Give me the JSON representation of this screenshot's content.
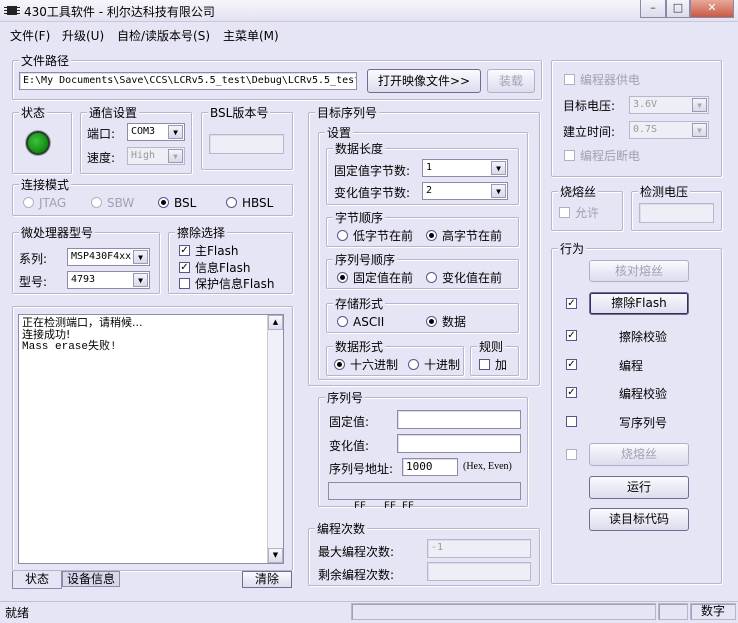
{
  "window": {
    "title": "430工具软件 - 利尔达科技有限公司"
  },
  "menu": [
    "文件(F)",
    "升级(U)",
    "自检/读版本号(S)",
    "主菜单(M)"
  ],
  "file_path": {
    "label": "文件路径",
    "value": "E:\\My Documents\\Save\\CCS\\LCRv5.5_test\\Debug\\LCRv5.5_test",
    "open_button": "打开映像文件>>",
    "load_button": "装载"
  },
  "power": {
    "supply_label": "编程器供电",
    "voltage_label": "目标电压:",
    "voltage_value": "3.6V",
    "setup_label": "建立时间:",
    "setup_value": "0.7S",
    "off_label": "编程后断电"
  },
  "status": {
    "label": "状态"
  },
  "comm": {
    "label": "通信设置",
    "port_label": "端口:",
    "port_value": "COM3",
    "speed_label": "速度:",
    "speed_value": "High"
  },
  "bsl": {
    "label": "BSL版本号"
  },
  "conn": {
    "label": "连接模式",
    "options": [
      "JTAG",
      "SBW",
      "BSL",
      "HBSL"
    ]
  },
  "mcu": {
    "label": "微处理器型号",
    "series_label": "系列:",
    "series_value": "MSP430F4xx",
    "model_label": "型号:",
    "model_value": "4793"
  },
  "erase": {
    "label": "擦除选择",
    "options": [
      "主Flash",
      "信息Flash",
      "保护信息Flash"
    ]
  },
  "log": {
    "lines": [
      "正在检测端口，请稍候...",
      "连接成功!",
      "Mass erase失败!"
    ]
  },
  "tabs": {
    "status": "状态",
    "device": "设备信息",
    "clear": "清除"
  },
  "serial": {
    "label": "目标序列号",
    "settings_label": "设置",
    "length": {
      "label": "数据长度",
      "fixed_label": "固定值字节数:",
      "fixed_value": "1",
      "var_label": "变化值字节数:",
      "var_value": "2"
    },
    "byte_order": {
      "label": "字节顺序",
      "options": [
        "低字节在前",
        "高字节在前"
      ]
    },
    "seq_order": {
      "label": "序列号顺序",
      "options": [
        "固定值在前",
        "变化值在前"
      ]
    },
    "storage": {
      "label": "存储形式",
      "options": [
        "ASCII",
        "数据"
      ]
    },
    "format": {
      "label": "数据形式",
      "options": [
        "十六进制",
        "十进制"
      ]
    },
    "rule": {
      "label": "规则",
      "add": "加"
    }
  },
  "serial_no": {
    "label": "序列号",
    "fixed_label": "固定值:",
    "var_label": "变化值:",
    "addr_label": "序列号地址:",
    "addr_value": "1000",
    "addr_hint": "(Hex, Even)",
    "preview": "FF   FF FF"
  },
  "count": {
    "label": "编程次数",
    "max_label": "最大编程次数:",
    "max_value": "-1",
    "remain_label": "剩余编程次数:",
    "remain_value": ""
  },
  "fuse": {
    "label": "烧熔丝",
    "allow": "允许"
  },
  "vdetect": {
    "label": "检测电压"
  },
  "actions": {
    "label": "行为",
    "verify_fuse": "核对熔丝",
    "erase_flash": "擦除Flash",
    "erase_check": "擦除校验",
    "program": "编程",
    "program_verify": "编程校验",
    "write_serial": "写序列号",
    "burn_fuse": "烧熔丝",
    "run": "运行",
    "read_code": "读目标代码"
  },
  "statusbar": {
    "ready": "就绪",
    "num": "数字"
  },
  "colors": {
    "background": "#e6e5f6",
    "led": "#118a11"
  }
}
